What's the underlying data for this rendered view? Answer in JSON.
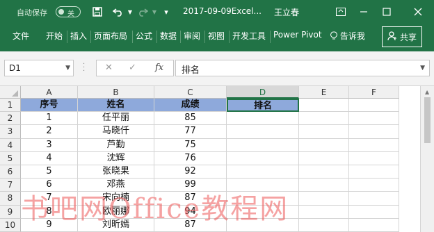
{
  "title_bar": {
    "autosave_label": "自动保存",
    "autosave_state": "关",
    "document_title": "2017-09-09Excel...",
    "user_name": "王立春"
  },
  "ribbon": {
    "tabs": [
      "文件",
      "开始",
      "插入",
      "页面布局",
      "公式",
      "数据",
      "审阅",
      "视图",
      "开发工具",
      "Power Pivot"
    ],
    "tell_me": "告诉我",
    "share": "共享"
  },
  "formula_bar": {
    "name_box": "D1",
    "content": "排名"
  },
  "sheet": {
    "columns": [
      "A",
      "B",
      "C",
      "D",
      "E",
      "F"
    ],
    "row_numbers": [
      "1",
      "2",
      "3",
      "4",
      "5",
      "6",
      "7",
      "8",
      "9",
      "10"
    ],
    "headers": [
      "序号",
      "姓名",
      "成绩",
      "排名"
    ],
    "rows": [
      [
        "1",
        "任平丽",
        "85",
        ""
      ],
      [
        "2",
        "马晓仟",
        "77",
        ""
      ],
      [
        "3",
        "芦勤",
        "75",
        ""
      ],
      [
        "4",
        "沈辉",
        "76",
        ""
      ],
      [
        "5",
        "张晓果",
        "92",
        ""
      ],
      [
        "6",
        "邓燕",
        "99",
        ""
      ],
      [
        "7",
        "宋向楠",
        "87",
        ""
      ],
      [
        "8",
        "欧丽娜",
        "94",
        ""
      ],
      [
        "9",
        "刘昕嫣",
        "87",
        ""
      ]
    ],
    "header_fill": "#8ea9db"
  },
  "watermark": "书吧网Office教程网",
  "colors": {
    "accent": "#217346",
    "header_fill": "#8ea9db"
  }
}
